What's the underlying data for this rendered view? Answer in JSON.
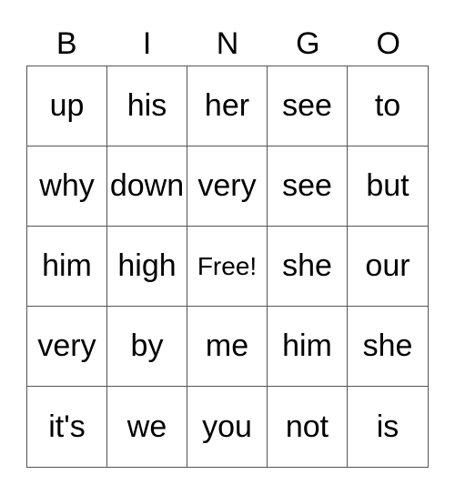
{
  "header": [
    "B",
    "I",
    "N",
    "G",
    "O"
  ],
  "rows": [
    [
      "up",
      "his",
      "her",
      "see",
      "to"
    ],
    [
      "why",
      "down",
      "very",
      "see",
      "but"
    ],
    [
      "him",
      "high",
      "Free!",
      "she",
      "our"
    ],
    [
      "very",
      "by",
      "me",
      "him",
      "she"
    ],
    [
      "it's",
      "we",
      "you",
      "not",
      "is"
    ]
  ]
}
